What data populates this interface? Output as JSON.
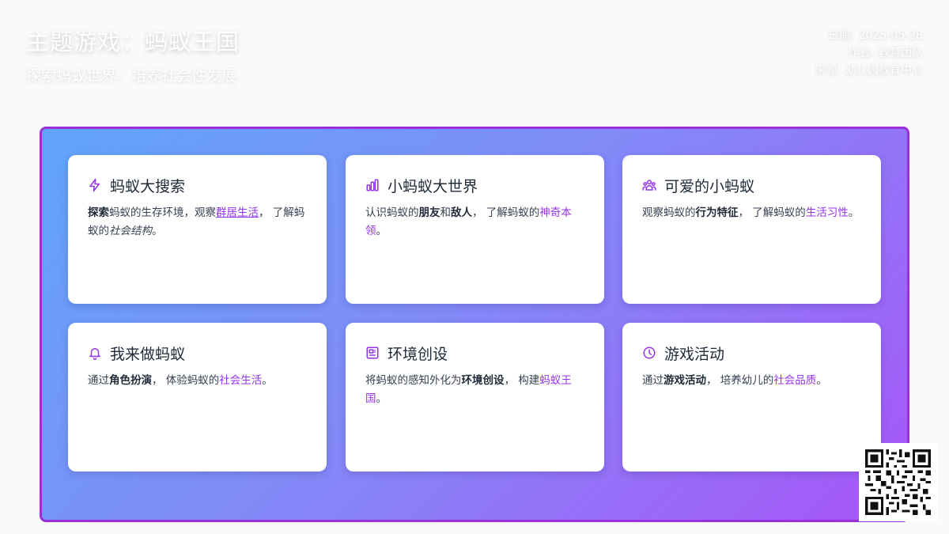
{
  "header": {
    "title": "主题游戏：蚂蚁王国",
    "subtitle": "探索蚂蚁世界，培养社会性发展",
    "meta": [
      {
        "label": "日期:",
        "value": "2025-05-28"
      },
      {
        "label": "作者:",
        "value": "教育团队"
      },
      {
        "label": "来源:",
        "value": "幼儿园教育中心"
      }
    ]
  },
  "colors": {
    "accent": "#9333ea",
    "panel_border": "#9b30d8",
    "gradient_start": "#60a5fa",
    "gradient_end": "#a855f7"
  },
  "cards": [
    {
      "icon": "lightning-icon",
      "title": "蚂蚁大搜索",
      "body": {
        "b1": "探索",
        "t1": "蚂蚁的生存环境，观察",
        "h1": "群居生活",
        "t2": "， 了解蚂蚁的",
        "i1": "社会结构",
        "t3": "。"
      }
    },
    {
      "icon": "bar-chart-icon",
      "title": "小蚂蚁大世界",
      "body": {
        "t1": "认识蚂蚁的",
        "b1": "朋友",
        "t2": "和",
        "b2": "敌人",
        "t3": "， 了解蚂蚁的",
        "h1": "神奇本领",
        "t4": "。"
      }
    },
    {
      "icon": "users-icon",
      "title": "可爱的小蚂蚁",
      "body": {
        "t1": "观察蚂蚁的",
        "b1": "行为特征",
        "t2": "， 了解蚂蚁的",
        "h1": "生活习性",
        "t3": "。"
      }
    },
    {
      "icon": "bell-icon",
      "title": "我来做蚂蚁",
      "body": {
        "t1": "通过",
        "b1": "角色扮演",
        "t2": "， 体验蚂蚁的",
        "h1": "社会生活",
        "t3": "。"
      }
    },
    {
      "icon": "newspaper-icon",
      "title": "环境创设",
      "body": {
        "t1": "将蚂蚁的感知外化为",
        "b1": "环境创设",
        "t2": "， 构建",
        "h1": "蚂蚁王国",
        "t3": "。"
      }
    },
    {
      "icon": "clock-icon",
      "title": "游戏活动",
      "body": {
        "t1": "通过",
        "b1": "游戏活动",
        "t2": "， 培养幼儿的",
        "h1": "社会品质",
        "t3": "。"
      }
    }
  ],
  "qr_code": {
    "icon": "qr-code-icon"
  }
}
